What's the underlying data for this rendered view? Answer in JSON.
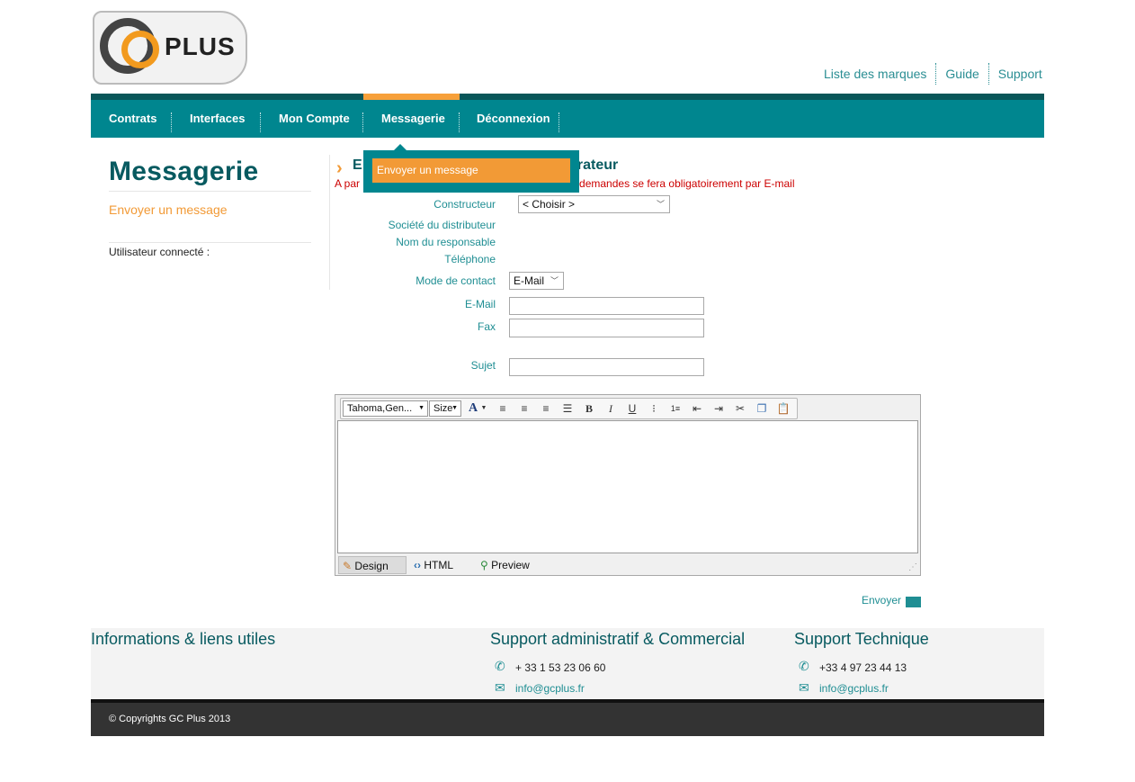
{
  "logo": {
    "brand_text": "PLUS"
  },
  "top_links": [
    "Liste des marques",
    "Guide",
    "Support"
  ],
  "nav": {
    "items": [
      "Contrats",
      "Interfaces",
      "Mon Compte",
      "Messagerie",
      "Déconnexion"
    ],
    "active": "Messagerie",
    "dropdown_item": "Envoyer un message"
  },
  "sidebar": {
    "title": "Messagerie",
    "link": "Envoyer un message",
    "user_label": "Utilisateur connecté :"
  },
  "form": {
    "title_start": "E",
    "title_end": "strateur",
    "notice_start": "A par",
    "notice_end": "demandes se fera obligatoirement par E-mail",
    "labels": {
      "constructeur": "Constructeur",
      "societe": "Société du distributeur",
      "responsable": "Nom du responsable",
      "telephone": "Téléphone",
      "mode": "Mode de contact",
      "email": "E-Mail",
      "fax": "Fax",
      "sujet": "Sujet"
    },
    "constructeur_value": "< Choisir >",
    "mode_value": "E-Mail"
  },
  "editor": {
    "font_select": "Tahoma,Gen...",
    "size_select": "Size",
    "modes": [
      "Design",
      "HTML",
      "Preview"
    ]
  },
  "send_label": "Envoyer",
  "footer": {
    "col1_title": "Informations & liens utiles",
    "col2_title": "Support administratif & Commercial",
    "col2_phone": "+ 33 1 53 23 06 60",
    "col2_email": "info@gcplus.fr",
    "col3_title": "Support Technique",
    "col3_phone": "+33 4 97 23 44 13",
    "col3_email": "info@gcplus.fr",
    "copyright": "© Copyrights GC Plus 2013"
  },
  "colors": {
    "teal": "#00868f",
    "dark_teal": "#075a60",
    "orange": "#f29a36",
    "red": "#cc0000"
  }
}
